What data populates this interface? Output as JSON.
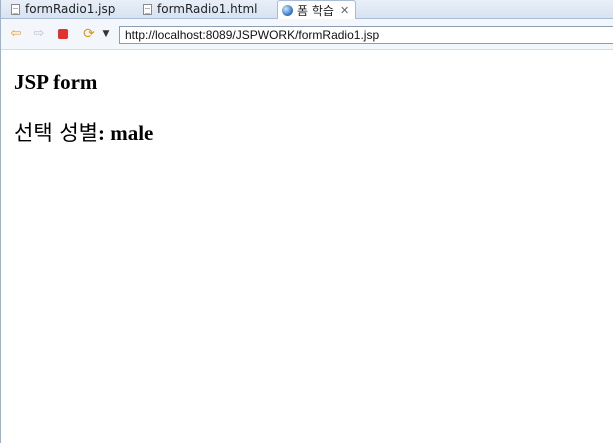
{
  "tabs": [
    {
      "label": "formRadio1.jsp",
      "icon": "file-icon"
    },
    {
      "label": "formRadio1.html",
      "icon": "file-icon"
    },
    {
      "label": "폼 학습",
      "icon": "globe-icon",
      "active": true
    }
  ],
  "toolbar": {
    "url": "http://localhost:8089/JSPWORK/formRadio1.jsp"
  },
  "page": {
    "heading": "JSP form",
    "result_label": "선택 성별",
    "result_sep": ": ",
    "result_value": "male"
  },
  "colors": {
    "stop": "#e2312c",
    "back_arrow": "#e8a21a",
    "tab_bar": "#d7e3f1"
  }
}
